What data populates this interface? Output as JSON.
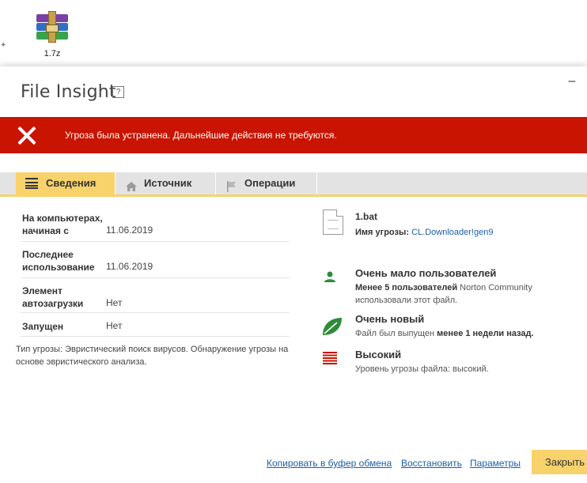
{
  "desktop": {
    "file_icon": "winrar-archive-icon",
    "file_label": "1.7z"
  },
  "dialog": {
    "title": "File Insight",
    "help_label": "?",
    "minimize_label": "–"
  },
  "banner": {
    "icon": "close-x-icon",
    "message": "Угроза была устранена. Дальнейшие действия не требуются.",
    "color": "#c81400"
  },
  "tabs": [
    {
      "label": "Сведения",
      "icon": "list-icon",
      "active": true
    },
    {
      "label": "Источник",
      "icon": "home-icon",
      "active": false
    },
    {
      "label": "Операции",
      "icon": "flag-icon",
      "active": false
    }
  ],
  "details": {
    "rows": [
      {
        "key": "На компьютерах, начиная с",
        "value": "11.06.2019"
      },
      {
        "key": "Последнее использование",
        "value": "11.06.2019"
      },
      {
        "key": "Элемент автозагрузки",
        "value": "Нет"
      },
      {
        "key": "Запущен",
        "value": "Нет"
      }
    ],
    "threat_type": "Тип угрозы: Эвристический поиск вирусов. Обнаружение угрозы на основе эвристического анализа."
  },
  "file_info": {
    "name": "1.bat",
    "threat_label": "Имя угрозы:",
    "threat_name": "CL.Downloader!gen9"
  },
  "ratings": {
    "users": {
      "title": "Очень мало пользователей",
      "sub_bold": "Менее 5 пользователей",
      "sub_rest": " Norton Community использовали этот файл."
    },
    "age": {
      "title": "Очень новый",
      "sub_pre": "Файл был выпущен ",
      "sub_bold": "менее 1 недели назад."
    },
    "risk": {
      "title": "Высокий",
      "sub": "Уровень угрозы файла: высокий."
    }
  },
  "footer": {
    "copy_label": "Копировать в буфер обмена",
    "restore_label": "Восстановить",
    "settings_label": "Параметры",
    "close_label": "Закрыть"
  },
  "colors": {
    "accent": "#f8d26a",
    "link": "#1a5faa",
    "danger": "#c81400",
    "green": "#2e8b3a"
  }
}
